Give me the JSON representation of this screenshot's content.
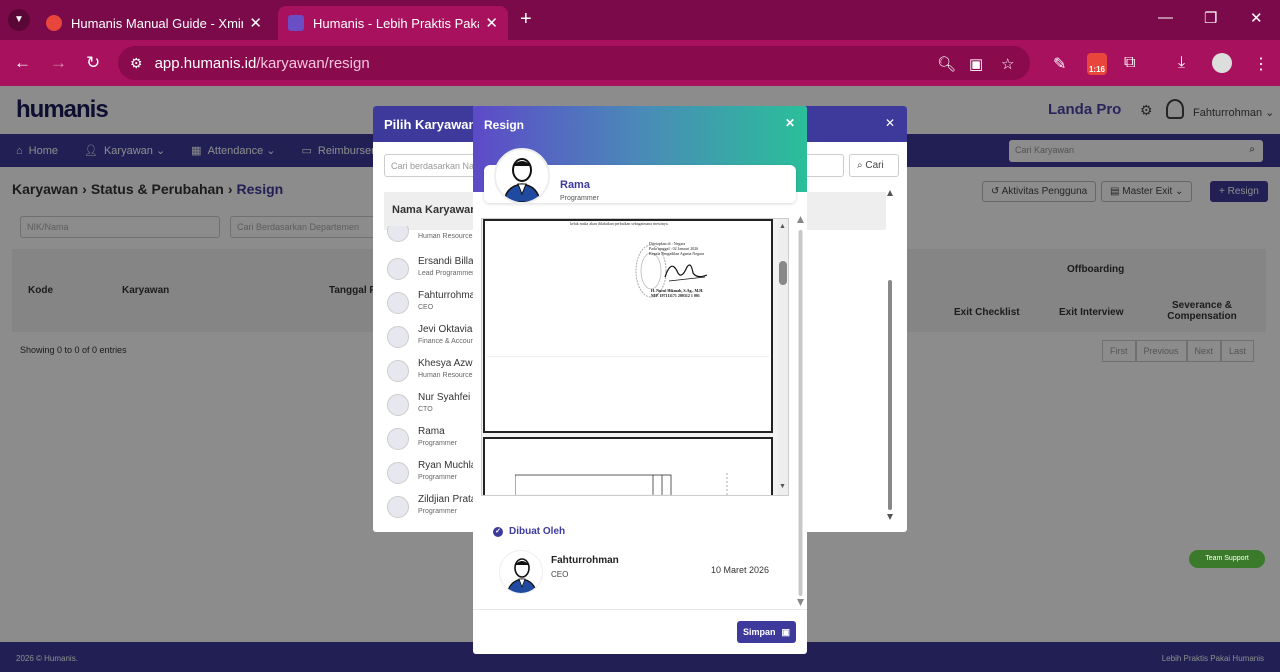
{
  "browser": {
    "tabs": [
      {
        "title": "Humanis Manual Guide - Xmind",
        "active": false
      },
      {
        "title": "Humanis - Lebih Praktis Pakai Humanis",
        "active": true
      }
    ],
    "url_host": "app.humanis.id",
    "url_path": "/karyawan/resign",
    "extension_badge": "1:16"
  },
  "app": {
    "logo": "humanis",
    "company": "Landa Pro",
    "user_name": "Fahturrohman",
    "nav": [
      {
        "label": "Home",
        "icon": "home-icon"
      },
      {
        "label": "Karyawan",
        "icon": "users-icon"
      },
      {
        "label": "Attendance",
        "icon": "calendar-icon"
      },
      {
        "label": "Reimbursement",
        "icon": "wallet-icon"
      }
    ],
    "nav_search_placeholder": "Cari Karyawan",
    "breadcrumb": [
      "Karyawan",
      "Status & Perubahan",
      "Resign"
    ],
    "buttons": {
      "aktivitas": "Aktivitas Pengguna",
      "master_exit": "Master Exit",
      "resign": "Resign"
    },
    "filters": {
      "nik": "NIK/Nama",
      "departemen": "Cari Berdasarkan Departemen"
    },
    "table": {
      "headers": {
        "kode": "Kode",
        "karyawan": "Karyawan",
        "tanggal": "Tanggal R",
        "offboarding": "Offboarding",
        "exit_checklist": "Exit Checklist",
        "exit_interview": "Exit Interview",
        "severance": "Severance & Compensation"
      },
      "showing": "Showing 0 to 0 of 0 entries",
      "pager": [
        "First",
        "Previous",
        "Next",
        "Last"
      ]
    },
    "footer": {
      "copyright": "2026 © Humanis.",
      "tagline": "Lebih Praktis Pakai Humanis"
    },
    "support": "Team Support"
  },
  "pilih_modal": {
    "title": "Pilih Karyawan",
    "search_placeholder": "Cari berdasarkan Nama",
    "cari": "Cari",
    "column": "Nama Karyawan",
    "employees": [
      {
        "name": "",
        "role": "Human Resource"
      },
      {
        "name": "Ersandi Billah",
        "role": "Lead Programmer"
      },
      {
        "name": "Fahturrohman",
        "role": "CEO"
      },
      {
        "name": "Jevi Oktavia",
        "role": "Finance & Accounting"
      },
      {
        "name": "Khesya Azwa",
        "role": "Human Resource"
      },
      {
        "name": "Nur Syahfei",
        "role": "CTO"
      },
      {
        "name": "Rama",
        "role": "Programmer"
      },
      {
        "name": "Ryan Muchlas",
        "role": "Programmer"
      },
      {
        "name": "Zildjian Pratama",
        "role": "Programmer"
      }
    ]
  },
  "resign_modal": {
    "title": "Resign",
    "employee": {
      "name": "Rama",
      "role": "Programmer"
    },
    "document": {
      "line1": "kelak maka akan dilakukan perbaikan sebagaimana mestinya.",
      "sig1": "Ditetapkan di   : Negara",
      "sig2": "Pada tanggal    : 02 Januari 2026",
      "sig3": "Kepala Pengadilan Agama Negara",
      "signer": "H. Nurul Hikmah, S.Ag., M.H.",
      "nip": "NIP. 197111171 200312 1 001"
    },
    "made_by_label": "Dibuat Oleh",
    "maker": {
      "name": "Fahturrohman",
      "role": "CEO",
      "date": "10 Maret 2026"
    },
    "save": "Simpan"
  }
}
